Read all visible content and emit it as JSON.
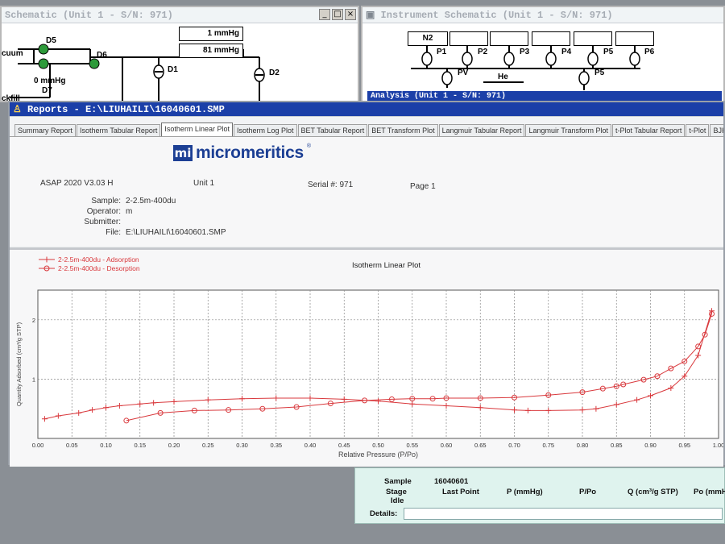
{
  "left_schematic": {
    "title": "Schematic (Unit 1 - S/N: 971)",
    "buttons": [
      "_",
      "□",
      "×"
    ],
    "pressure_box_1": "1 mmHg",
    "pressure_box_2": "81 mmHg",
    "labels": {
      "d5": "D5",
      "d6": "D6",
      "d1": "D1",
      "d2": "D2",
      "d7": "D7",
      "vacuum": "cuum",
      "backfill": "ckfill",
      "zero_mmhg": "0 mmHg"
    }
  },
  "right_schematic": {
    "title": "Instrument Schematic (Unit 1 - S/N: 971)",
    "n2_label": "N2",
    "ports": [
      "P1",
      "P2",
      "P3",
      "P4",
      "P5",
      "P6"
    ],
    "pv_label": "PV",
    "he_label": "He",
    "p5_label": "P5",
    "behind_title": "Analysis (Unit 1 - S/N: 971)"
  },
  "reports": {
    "title": "Reports - E:\\LIUHAILI\\16040601.SMP",
    "tabs": [
      "Summary Report",
      "Isotherm Tabular Report",
      "Isotherm Linear Plot",
      "Isotherm Log Plot",
      "BET Tabular Report",
      "BET Transform Plot",
      "Langmuir Tabular Report",
      "Langmuir Transform Plot",
      "t-Plot Tabular Report",
      "t-Plot",
      "BJH A"
    ],
    "active_tab": "Isotherm Linear Plot",
    "tab_scroll": "◀ ▶",
    "logo_mark": "mi",
    "logo_text": "micromeritics",
    "version": "ASAP 2020 V3.03 H",
    "unit": "Unit 1",
    "serial": "Serial #: 971",
    "page": "Page  1",
    "fields": [
      {
        "label": "Sample:",
        "value": "2-2.5m-400du"
      },
      {
        "label": "Operator:",
        "value": "m"
      },
      {
        "label": "Submitter:",
        "value": ""
      },
      {
        "label": "File:",
        "value": "E:\\LIUHAILI\\16040601.SMP"
      }
    ]
  },
  "status_panel": {
    "sample_label": "Sample",
    "sample_value": "16040601",
    "stage_label": "Stage",
    "stage_value": "Idle",
    "last_point": "Last Point",
    "p_col": "P (mmHg)",
    "ppo_col": "P/Po",
    "q_col": "Q (cm³/g STP)",
    "po_col": "Po (mmH",
    "details_label": "Details:"
  },
  "colors": {
    "series": "#d9393d",
    "title_active": "#1b3fa8",
    "logo": "#1c3f94"
  },
  "chart_data": {
    "type": "line",
    "title": "Isotherm Linear Plot",
    "xlabel": "Relative Pressure (P/Po)",
    "ylabel": "Quantity Adsorbed (cm³/g STP)",
    "xlim": [
      0.0,
      1.0
    ],
    "ylim": [
      0,
      2.5
    ],
    "xticks": [
      "0.00",
      "0.05",
      "0.10",
      "0.15",
      "0.20",
      "0.25",
      "0.30",
      "0.35",
      "0.40",
      "0.45",
      "0.50",
      "0.55",
      "0.60",
      "0.65",
      "0.70",
      "0.75",
      "0.80",
      "0.85",
      "0.90",
      "0.95",
      "1.00"
    ],
    "yticks": [
      "1",
      "2"
    ],
    "grid": true,
    "legend_position": "top-left",
    "series": [
      {
        "name": "2-2.5m-400du - Adsorption",
        "marker": "plus",
        "x": [
          0.01,
          0.03,
          0.06,
          0.08,
          0.1,
          0.12,
          0.15,
          0.17,
          0.2,
          0.25,
          0.3,
          0.35,
          0.4,
          0.45,
          0.5,
          0.55,
          0.6,
          0.65,
          0.7,
          0.72,
          0.75,
          0.8,
          0.82,
          0.85,
          0.88,
          0.9,
          0.93,
          0.95,
          0.97,
          0.99
        ],
        "y": [
          0.33,
          0.38,
          0.43,
          0.48,
          0.52,
          0.55,
          0.58,
          0.6,
          0.62,
          0.65,
          0.67,
          0.68,
          0.68,
          0.66,
          0.63,
          0.58,
          0.55,
          0.52,
          0.48,
          0.47,
          0.47,
          0.48,
          0.5,
          0.57,
          0.65,
          0.72,
          0.85,
          1.05,
          1.4,
          2.15
        ]
      },
      {
        "name": "2-2.5m-400du - Desorption",
        "marker": "circle",
        "x": [
          0.99,
          0.98,
          0.97,
          0.95,
          0.93,
          0.91,
          0.89,
          0.86,
          0.85,
          0.83,
          0.8,
          0.75,
          0.7,
          0.65,
          0.6,
          0.58,
          0.55,
          0.52,
          0.48,
          0.43,
          0.38,
          0.33,
          0.28,
          0.23,
          0.18,
          0.13
        ],
        "y": [
          2.1,
          1.75,
          1.55,
          1.3,
          1.18,
          1.05,
          0.99,
          0.91,
          0.88,
          0.84,
          0.78,
          0.73,
          0.69,
          0.68,
          0.68,
          0.67,
          0.67,
          0.66,
          0.64,
          0.59,
          0.53,
          0.5,
          0.48,
          0.47,
          0.43,
          0.3
        ]
      }
    ]
  }
}
